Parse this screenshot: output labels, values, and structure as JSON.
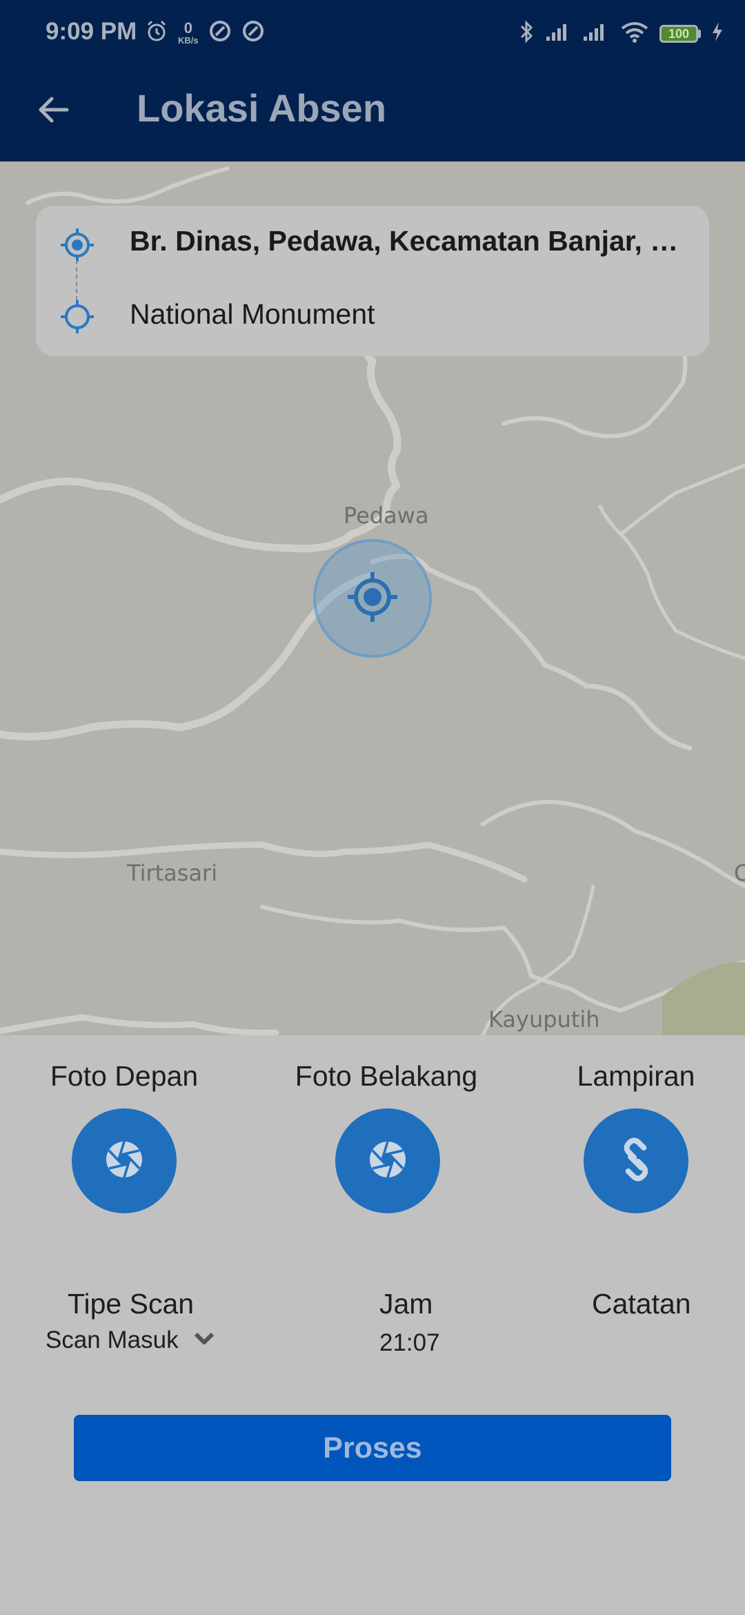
{
  "status_bar": {
    "time": "9:09 PM",
    "net_speed_value": "0",
    "net_speed_unit": "KB/s",
    "battery": "100",
    "icons": [
      "alarm-icon",
      "data-saver-icon",
      "data-saver-icon",
      "bluetooth-icon",
      "signal-icon",
      "signal-icon",
      "wifi-icon",
      "battery-icon",
      "charging-icon"
    ]
  },
  "app_bar": {
    "back_icon": "arrow-left-icon",
    "title": "Lokasi Absen"
  },
  "route": {
    "origin": "Br. Dinas, Pedawa, Kecamatan Banjar, Kabupaten Buleleng, Bali",
    "destination": "National Monument",
    "origin_icon": "gps-fixed-icon",
    "destination_icon": "gps-not-fixed-icon"
  },
  "map": {
    "labels": [
      "Pedawa",
      "Tirtasari",
      "Kayuputih",
      "C"
    ],
    "locate_icon": "my-location-icon"
  },
  "attachments": [
    {
      "label": "Foto Depan",
      "icon": "camera-shutter-icon"
    },
    {
      "label": "Foto Belakang",
      "icon": "camera-shutter-icon"
    },
    {
      "label": "Lampiran",
      "icon": "link-icon"
    }
  ],
  "info": {
    "scan_type_label": "Tipe Scan",
    "scan_type_value": "Scan Masuk",
    "time_label": "Jam",
    "time_value": "21:07",
    "note_label": "Catatan"
  },
  "actions": {
    "process_label": "Proses"
  },
  "colors": {
    "app_bar": "#03214e",
    "accent": "#1f6fbd",
    "button": "#0056bd"
  }
}
